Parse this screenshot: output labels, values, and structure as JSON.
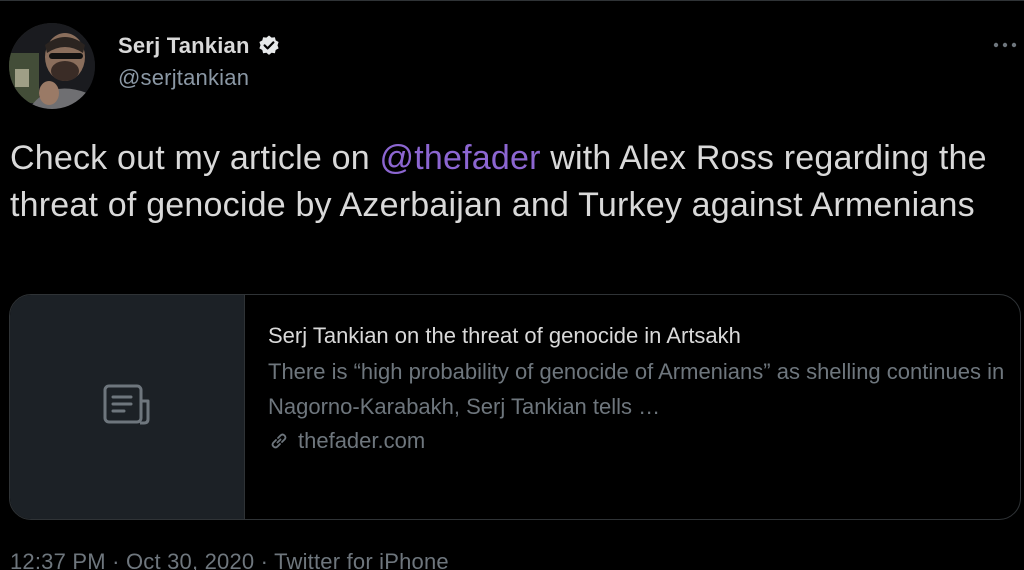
{
  "author": {
    "display_name": "Serj Tankian",
    "handle": "@serjtankian",
    "verified": true
  },
  "tweet": {
    "text_before": "Check out my article on ",
    "mention": "@thefader",
    "text_after": " with Alex Ross regarding the threat of genocide by Azerbaijan and Turkey against Armenians"
  },
  "card": {
    "thumbnail_icon": "document-icon",
    "title": "Serj Tankian on the threat of genocide in Artsakh",
    "description": "There is “high probability of genocide of Armenians” as shelling continues in Nagorno-Karabakh, Serj Tankian tells …",
    "domain": "thefader.com"
  },
  "meta": {
    "time": "12:37 PM",
    "separator": " · ",
    "date": "Oct 30, 2020",
    "source": "Twitter for iPhone"
  },
  "more_icon": "more-options-icon",
  "colors": {
    "background": "#000000",
    "mention": "#8c66d1",
    "secondary_text": "#6e767d",
    "primary_text": "#d9d9d9"
  }
}
